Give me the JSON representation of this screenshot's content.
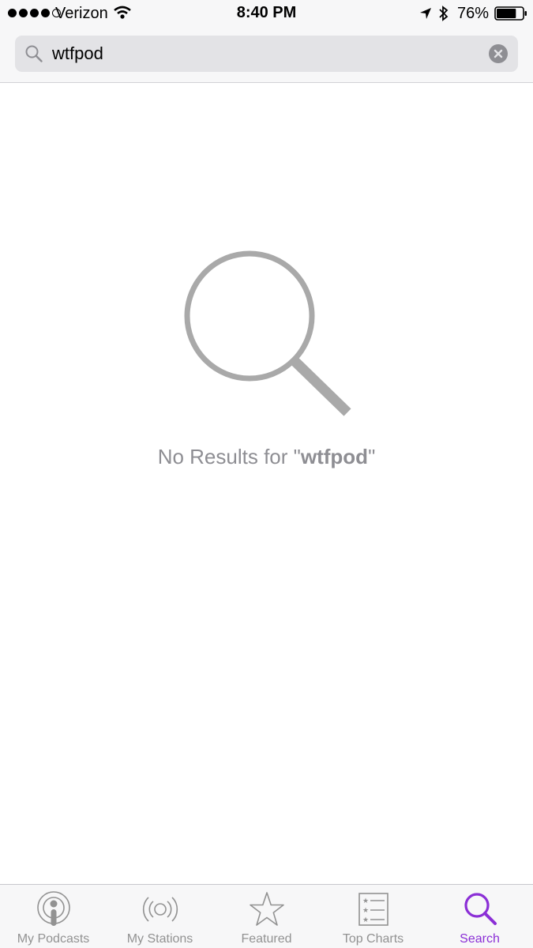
{
  "status_bar": {
    "carrier": "Verizon",
    "time": "8:40 PM",
    "battery_percent": "76%",
    "signal_bars_filled": 4,
    "signal_bars_total": 5,
    "battery_level": 0.76
  },
  "search": {
    "query": "wtfpod",
    "placeholder": "Search"
  },
  "empty_state": {
    "prefix": "No Results for \"",
    "query": "wtfpod",
    "suffix": "\""
  },
  "tab_bar": {
    "tabs": [
      {
        "label": "My Podcasts",
        "icon": "podcast-icon",
        "active": false
      },
      {
        "label": "My Stations",
        "icon": "radio-waves-icon",
        "active": false
      },
      {
        "label": "Featured",
        "icon": "star-icon",
        "active": false
      },
      {
        "label": "Top Charts",
        "icon": "list-icon",
        "active": false
      },
      {
        "label": "Search",
        "icon": "search-icon",
        "active": true
      }
    ]
  },
  "colors": {
    "accent": "#8b2fd6",
    "inactive_tab": "#929292",
    "empty_state_text": "#8e8e93"
  }
}
